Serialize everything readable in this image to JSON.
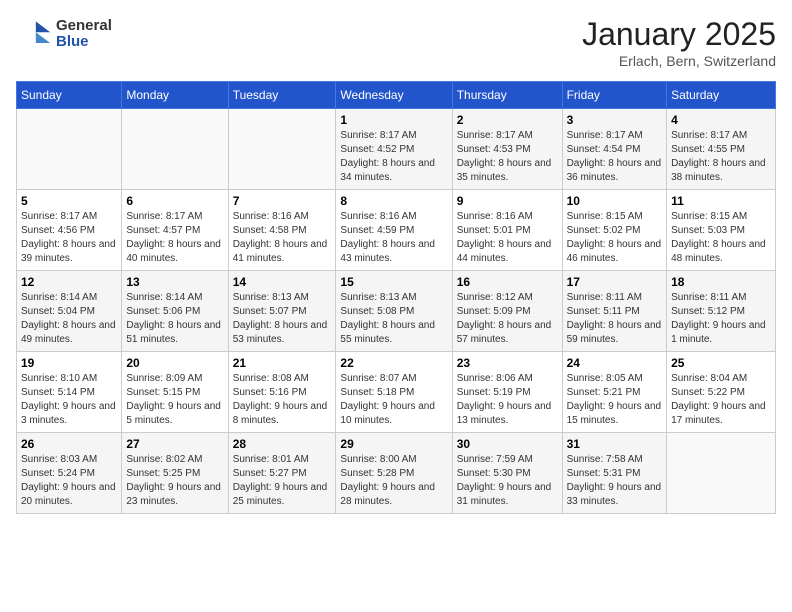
{
  "header": {
    "logo_general": "General",
    "logo_blue": "Blue",
    "title": "January 2025",
    "subtitle": "Erlach, Bern, Switzerland"
  },
  "weekdays": [
    "Sunday",
    "Monday",
    "Tuesday",
    "Wednesday",
    "Thursday",
    "Friday",
    "Saturday"
  ],
  "weeks": [
    [
      {
        "day": "",
        "sunrise": "",
        "sunset": "",
        "daylight": ""
      },
      {
        "day": "",
        "sunrise": "",
        "sunset": "",
        "daylight": ""
      },
      {
        "day": "",
        "sunrise": "",
        "sunset": "",
        "daylight": ""
      },
      {
        "day": "1",
        "sunrise": "Sunrise: 8:17 AM",
        "sunset": "Sunset: 4:52 PM",
        "daylight": "Daylight: 8 hours and 34 minutes."
      },
      {
        "day": "2",
        "sunrise": "Sunrise: 8:17 AM",
        "sunset": "Sunset: 4:53 PM",
        "daylight": "Daylight: 8 hours and 35 minutes."
      },
      {
        "day": "3",
        "sunrise": "Sunrise: 8:17 AM",
        "sunset": "Sunset: 4:54 PM",
        "daylight": "Daylight: 8 hours and 36 minutes."
      },
      {
        "day": "4",
        "sunrise": "Sunrise: 8:17 AM",
        "sunset": "Sunset: 4:55 PM",
        "daylight": "Daylight: 8 hours and 38 minutes."
      }
    ],
    [
      {
        "day": "5",
        "sunrise": "Sunrise: 8:17 AM",
        "sunset": "Sunset: 4:56 PM",
        "daylight": "Daylight: 8 hours and 39 minutes."
      },
      {
        "day": "6",
        "sunrise": "Sunrise: 8:17 AM",
        "sunset": "Sunset: 4:57 PM",
        "daylight": "Daylight: 8 hours and 40 minutes."
      },
      {
        "day": "7",
        "sunrise": "Sunrise: 8:16 AM",
        "sunset": "Sunset: 4:58 PM",
        "daylight": "Daylight: 8 hours and 41 minutes."
      },
      {
        "day": "8",
        "sunrise": "Sunrise: 8:16 AM",
        "sunset": "Sunset: 4:59 PM",
        "daylight": "Daylight: 8 hours and 43 minutes."
      },
      {
        "day": "9",
        "sunrise": "Sunrise: 8:16 AM",
        "sunset": "Sunset: 5:01 PM",
        "daylight": "Daylight: 8 hours and 44 minutes."
      },
      {
        "day": "10",
        "sunrise": "Sunrise: 8:15 AM",
        "sunset": "Sunset: 5:02 PM",
        "daylight": "Daylight: 8 hours and 46 minutes."
      },
      {
        "day": "11",
        "sunrise": "Sunrise: 8:15 AM",
        "sunset": "Sunset: 5:03 PM",
        "daylight": "Daylight: 8 hours and 48 minutes."
      }
    ],
    [
      {
        "day": "12",
        "sunrise": "Sunrise: 8:14 AM",
        "sunset": "Sunset: 5:04 PM",
        "daylight": "Daylight: 8 hours and 49 minutes."
      },
      {
        "day": "13",
        "sunrise": "Sunrise: 8:14 AM",
        "sunset": "Sunset: 5:06 PM",
        "daylight": "Daylight: 8 hours and 51 minutes."
      },
      {
        "day": "14",
        "sunrise": "Sunrise: 8:13 AM",
        "sunset": "Sunset: 5:07 PM",
        "daylight": "Daylight: 8 hours and 53 minutes."
      },
      {
        "day": "15",
        "sunrise": "Sunrise: 8:13 AM",
        "sunset": "Sunset: 5:08 PM",
        "daylight": "Daylight: 8 hours and 55 minutes."
      },
      {
        "day": "16",
        "sunrise": "Sunrise: 8:12 AM",
        "sunset": "Sunset: 5:09 PM",
        "daylight": "Daylight: 8 hours and 57 minutes."
      },
      {
        "day": "17",
        "sunrise": "Sunrise: 8:11 AM",
        "sunset": "Sunset: 5:11 PM",
        "daylight": "Daylight: 8 hours and 59 minutes."
      },
      {
        "day": "18",
        "sunrise": "Sunrise: 8:11 AM",
        "sunset": "Sunset: 5:12 PM",
        "daylight": "Daylight: 9 hours and 1 minute."
      }
    ],
    [
      {
        "day": "19",
        "sunrise": "Sunrise: 8:10 AM",
        "sunset": "Sunset: 5:14 PM",
        "daylight": "Daylight: 9 hours and 3 minutes."
      },
      {
        "day": "20",
        "sunrise": "Sunrise: 8:09 AM",
        "sunset": "Sunset: 5:15 PM",
        "daylight": "Daylight: 9 hours and 5 minutes."
      },
      {
        "day": "21",
        "sunrise": "Sunrise: 8:08 AM",
        "sunset": "Sunset: 5:16 PM",
        "daylight": "Daylight: 9 hours and 8 minutes."
      },
      {
        "day": "22",
        "sunrise": "Sunrise: 8:07 AM",
        "sunset": "Sunset: 5:18 PM",
        "daylight": "Daylight: 9 hours and 10 minutes."
      },
      {
        "day": "23",
        "sunrise": "Sunrise: 8:06 AM",
        "sunset": "Sunset: 5:19 PM",
        "daylight": "Daylight: 9 hours and 13 minutes."
      },
      {
        "day": "24",
        "sunrise": "Sunrise: 8:05 AM",
        "sunset": "Sunset: 5:21 PM",
        "daylight": "Daylight: 9 hours and 15 minutes."
      },
      {
        "day": "25",
        "sunrise": "Sunrise: 8:04 AM",
        "sunset": "Sunset: 5:22 PM",
        "daylight": "Daylight: 9 hours and 17 minutes."
      }
    ],
    [
      {
        "day": "26",
        "sunrise": "Sunrise: 8:03 AM",
        "sunset": "Sunset: 5:24 PM",
        "daylight": "Daylight: 9 hours and 20 minutes."
      },
      {
        "day": "27",
        "sunrise": "Sunrise: 8:02 AM",
        "sunset": "Sunset: 5:25 PM",
        "daylight": "Daylight: 9 hours and 23 minutes."
      },
      {
        "day": "28",
        "sunrise": "Sunrise: 8:01 AM",
        "sunset": "Sunset: 5:27 PM",
        "daylight": "Daylight: 9 hours and 25 minutes."
      },
      {
        "day": "29",
        "sunrise": "Sunrise: 8:00 AM",
        "sunset": "Sunset: 5:28 PM",
        "daylight": "Daylight: 9 hours and 28 minutes."
      },
      {
        "day": "30",
        "sunrise": "Sunrise: 7:59 AM",
        "sunset": "Sunset: 5:30 PM",
        "daylight": "Daylight: 9 hours and 31 minutes."
      },
      {
        "day": "31",
        "sunrise": "Sunrise: 7:58 AM",
        "sunset": "Sunset: 5:31 PM",
        "daylight": "Daylight: 9 hours and 33 minutes."
      },
      {
        "day": "",
        "sunrise": "",
        "sunset": "",
        "daylight": ""
      }
    ]
  ]
}
